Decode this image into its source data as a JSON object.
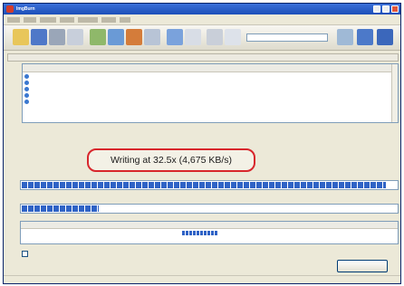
{
  "window": {
    "title": "ImgBurn"
  },
  "status": {
    "writing_text": "Writing at 32.5x (4,675 KB/s)"
  },
  "progress": {
    "buffer_fraction": 0.97,
    "completed_fraction": 0.21
  },
  "device": {
    "fill_fraction": 0.97
  },
  "colors": {
    "accent": "#2f63c6",
    "callout": "#d8262c",
    "titlebar": "#1c4fb8"
  }
}
